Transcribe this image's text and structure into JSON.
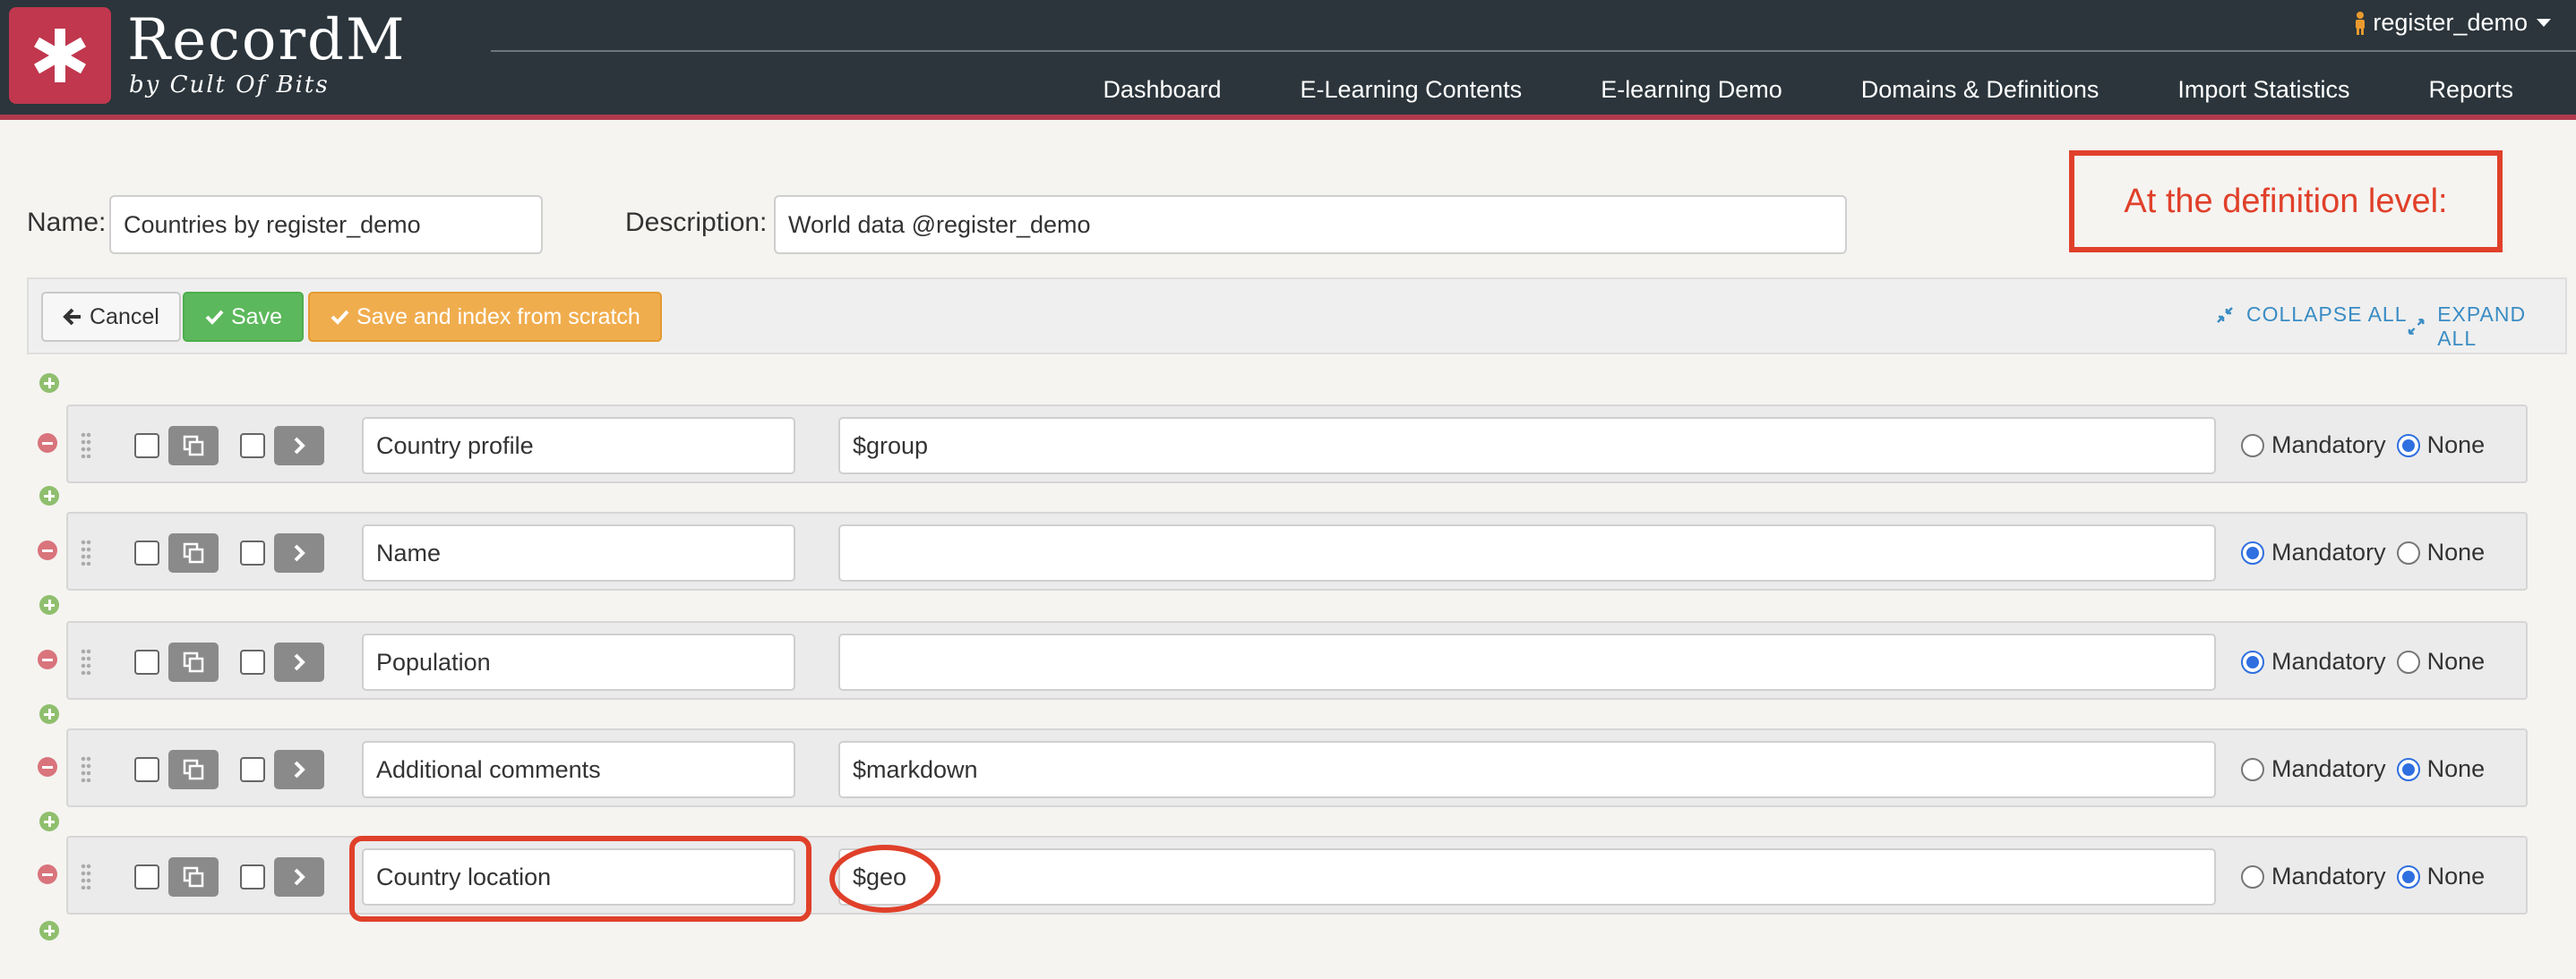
{
  "header": {
    "brand_title": "RecordM",
    "brand_sub": "by Cult Of Bits",
    "user": "register_demo",
    "nav": [
      "Dashboard",
      "E-Learning Contents",
      "E-learning Demo",
      "Domains & Definitions",
      "Import Statistics",
      "Reports"
    ]
  },
  "form": {
    "name_label": "Name:",
    "name_value": "Countries by register_demo",
    "description_label": "Description:",
    "description_value": "World data @register_demo"
  },
  "callout": "At the definition level:",
  "toolbar": {
    "cancel": "Cancel",
    "save": "Save",
    "save_index": "Save and index from scratch",
    "collapse_all": "COLLAPSE ALL",
    "expand_all": "EXPAND ALL"
  },
  "radio_labels": {
    "mandatory": "Mandatory",
    "none": "None"
  },
  "fields": [
    {
      "name": "Country profile",
      "description": "$group",
      "mandatory": false
    },
    {
      "name": "Name",
      "description": "",
      "mandatory": true
    },
    {
      "name": "Population",
      "description": "",
      "mandatory": true
    },
    {
      "name": "Additional comments",
      "description": "$markdown",
      "mandatory": false
    },
    {
      "name": "Country location",
      "description": "$geo",
      "mandatory": false
    }
  ],
  "colors": {
    "header_bg": "#2b353b",
    "accent": "#b33a4e",
    "save_green": "#5cb85c",
    "index_orange": "#f0ad4e",
    "link_blue": "#3a8cc4",
    "annotation_red": "#e0402a"
  }
}
